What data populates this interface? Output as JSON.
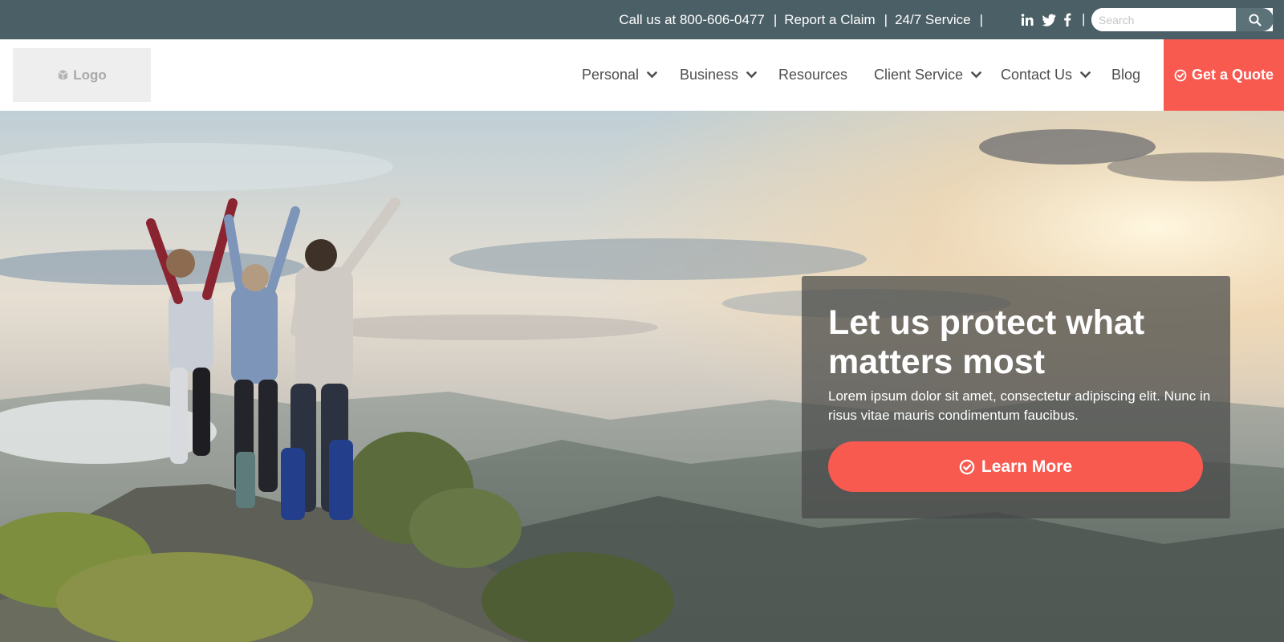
{
  "topbar": {
    "call": "Call us at 800-606-0477",
    "separator": "|",
    "report_claim": "Report a Claim",
    "service": "24/7 Service",
    "social": [
      "linkedin-icon",
      "twitter-icon",
      "facebook-icon"
    ],
    "search_placeholder": "Search"
  },
  "header": {
    "logo_label": "Logo",
    "nav": [
      {
        "label": "Personal",
        "has_dropdown": true
      },
      {
        "label": "Business",
        "has_dropdown": true
      },
      {
        "label": "Resources",
        "has_dropdown": false
      },
      {
        "label": "Client Service",
        "has_dropdown": true
      },
      {
        "label": "Contact Us",
        "has_dropdown": true
      },
      {
        "label": "Blog",
        "has_dropdown": false
      }
    ],
    "cta_label": "Get a Quote"
  },
  "hero": {
    "title": "Let us protect what matters most",
    "text": "Lorem ipsum dolor sit amet, consectetur adipiscing elit. Nunc in risus vitae mauris condimentum faucibus.",
    "button_label": "Learn More"
  },
  "colors": {
    "topbar_bg": "#4b5f66",
    "accent": "#f85a50",
    "nav_text": "#4e4e4e"
  }
}
